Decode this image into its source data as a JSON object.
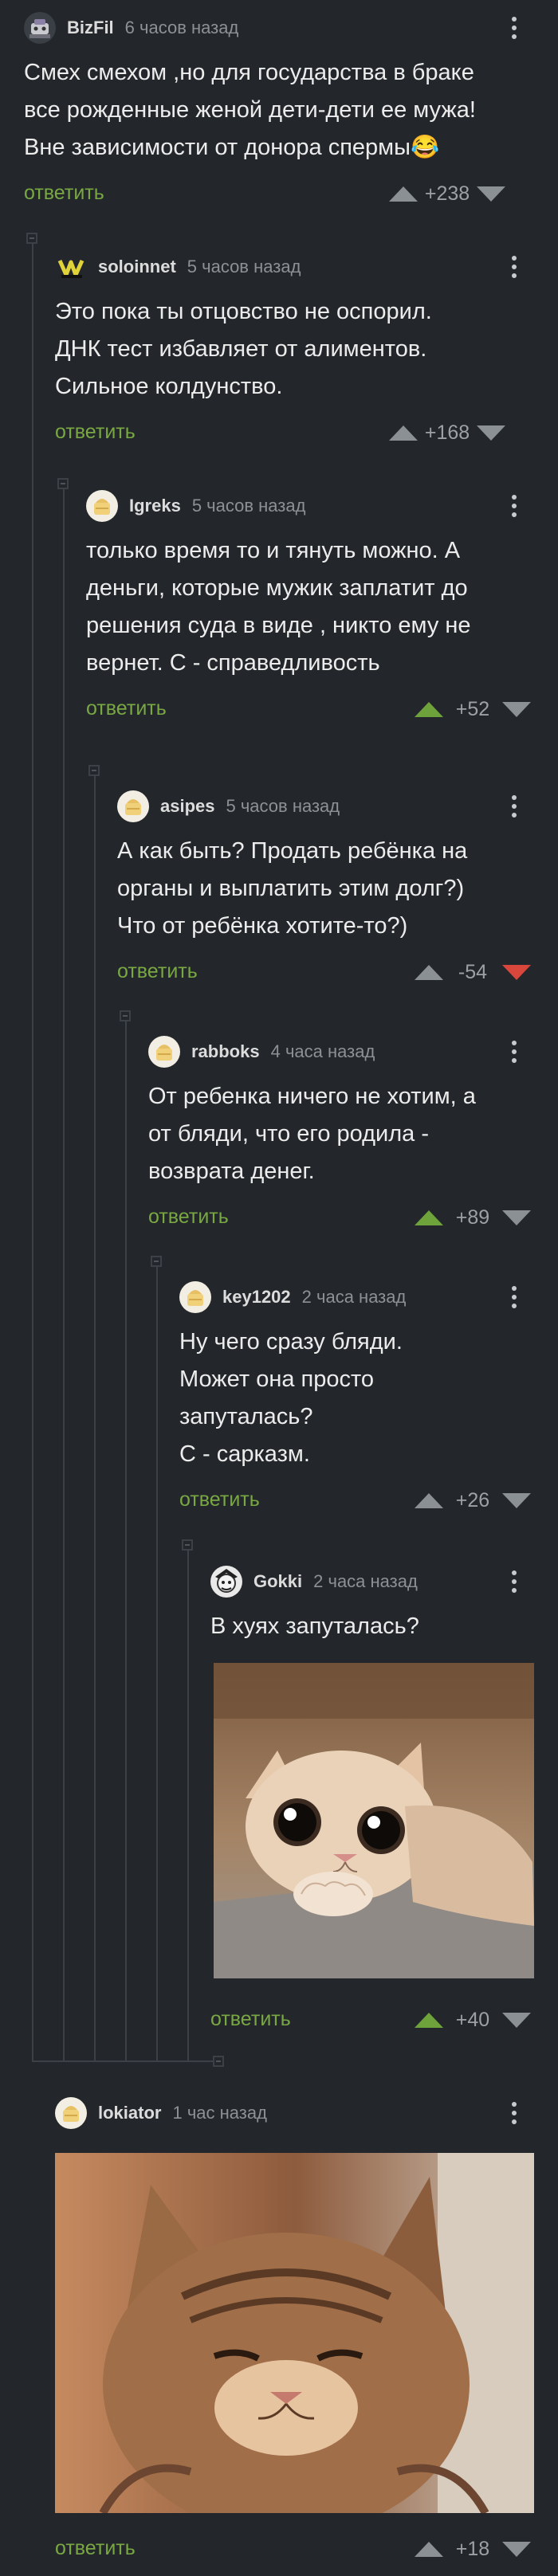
{
  "comments": [
    {
      "username": "BizFil",
      "time": "6 часов назад",
      "text": "Смех смехом ,но для государства в браке\nвсе рожденные женой дети-дети ее мужа!\nВне зависимости от донора спермы😂",
      "reply": "ответить",
      "score": "+238",
      "vote": "none"
    },
    {
      "username": "soloinnet",
      "time": "5 часов назад",
      "text": "Это пока ты отцовство не оспорил.\nДНК тест избавляет от алиментов.\nСильное колдунство.",
      "reply": "ответить",
      "score": "+168",
      "vote": "none"
    },
    {
      "username": "Igreks",
      "time": "5 часов назад",
      "text": "только время то и тянуть можно. А\nденьги, которые мужик заплатит до\nрешения суда в виде , никто ему не\nвернет. С - справедливость",
      "reply": "ответить",
      "score": "+52",
      "vote": "up"
    },
    {
      "username": "asipes",
      "time": "5 часов назад",
      "text": "А как быть? Продать ребёнка на\nорганы и выплатить этим долг?)\nЧто от ребёнка хотите-то?)",
      "reply": "ответить",
      "score": "-54",
      "vote": "down"
    },
    {
      "username": "rabboks",
      "time": "4 часа назад",
      "text": "От ребенка ничего не хотим, а\nот бляди, что его родила -\nвозврата денег.",
      "reply": "ответить",
      "score": "+89",
      "vote": "up"
    },
    {
      "username": "key1202",
      "time": "2 часа назад",
      "text": "Ну чего сразу бляди.\nМожет она просто\nзапуталась?\nС - сарказм.",
      "reply": "ответить",
      "score": "+26",
      "vote": "none"
    },
    {
      "username": "Gokki",
      "time": "2 часа назад",
      "text": "В хуях запуталась?",
      "reply": "ответить",
      "score": "+40",
      "vote": "up"
    },
    {
      "username": "lokiator",
      "time": "1 час назад",
      "text": "",
      "reply": "ответить",
      "score": "+18",
      "vote": "none"
    }
  ],
  "colors": {
    "background": "#23272b",
    "reply": "#79a843",
    "upvote": "#6ea23a",
    "downvote": "#d9473c",
    "thread": "#3c4147"
  }
}
